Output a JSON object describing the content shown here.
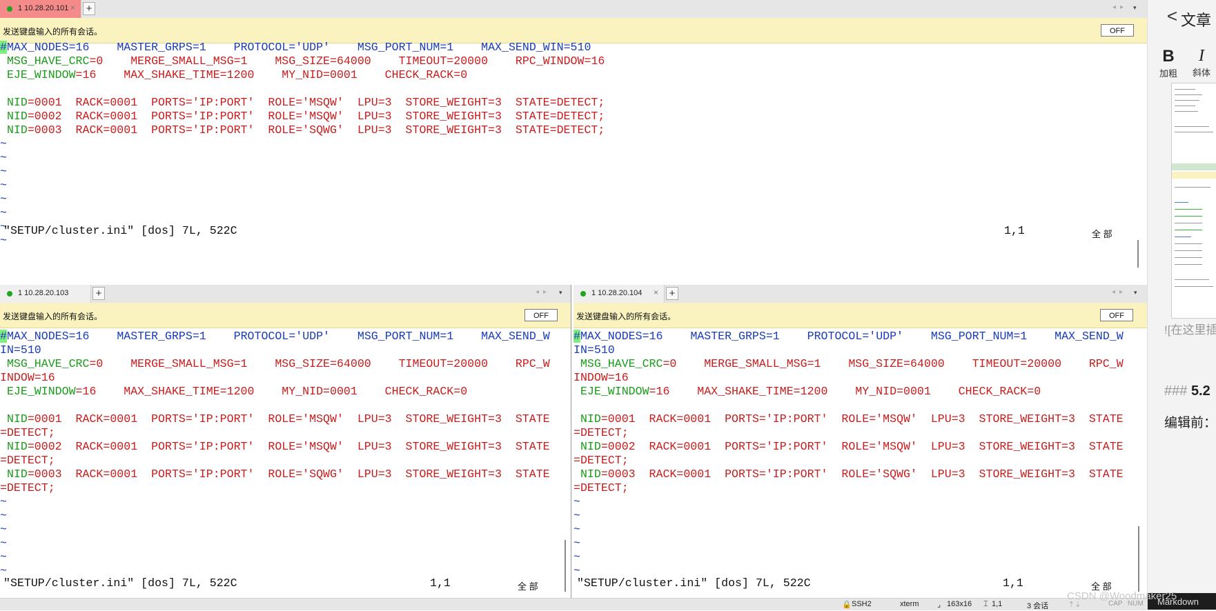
{
  "colors": {
    "key_blue": "#1a3cb8",
    "key_green": "#1a9c1a",
    "value_red": "#c81d1d",
    "plain": "#222222",
    "broadcast_bg": "#faf3c0",
    "active_tab": "#f48a8a"
  },
  "broadcast": {
    "text": "发送键盘输入的所有会话。",
    "off": "OFF"
  },
  "tabs": {
    "top": {
      "label": "1 10.28.20.101",
      "close": "×"
    },
    "bottom_left": {
      "label": "1 10.28.20.103"
    },
    "bottom_right": {
      "label": "1 10.28.20.104",
      "close": "×"
    },
    "add": "+"
  },
  "editor": {
    "tilde": "~",
    "status_file": "\"SETUP/cluster.ini\" [dos] 7L, 522C",
    "status_pos": "1,1",
    "status_all": "全 部"
  },
  "top_lines": [
    [
      [
        "#",
        "cursor"
      ],
      [
        "MAX_NODES",
        "b"
      ],
      [
        "=16    ",
        "b"
      ],
      [
        "MASTER_GRPS=1    ",
        "b"
      ],
      [
        "PROTOCOL='UDP'    ",
        "b"
      ],
      [
        "MSG_PORT_NUM=1    ",
        "b"
      ],
      [
        "MAX_SEND_WIN=510",
        "b"
      ]
    ],
    [
      [
        " MSG_HAVE_CRC",
        "g"
      ],
      [
        "=0    ",
        "r"
      ],
      [
        "MERGE_SMALL_MSG=1    ",
        "r"
      ],
      [
        "MSG_SIZE=64000    ",
        "r"
      ],
      [
        "TIMEOUT=20000    ",
        "r"
      ],
      [
        "RPC_WINDOW=16",
        "r"
      ]
    ],
    [
      [
        " EJE_WINDOW",
        "g"
      ],
      [
        "=16    ",
        "r"
      ],
      [
        "MAX_SHAKE_TIME=1200    ",
        "r"
      ],
      [
        "MY_NID=0001    ",
        "r"
      ],
      [
        "CHECK_RACK=0",
        "r"
      ]
    ],
    [
      [
        "",
        "p"
      ]
    ],
    [
      [
        " NID",
        "g"
      ],
      [
        "=0001  RACK=0001  PORTS='IP:PORT'  ROLE='MSQW'  LPU=3  STORE_WEIGHT=3  STATE=DETECT;",
        "r"
      ]
    ],
    [
      [
        " NID",
        "g"
      ],
      [
        "=0002  RACK=0001  PORTS='IP:PORT'  ROLE='MSQW'  LPU=3  STORE_WEIGHT=3  STATE=DETECT;",
        "r"
      ]
    ],
    [
      [
        " NID",
        "g"
      ],
      [
        "=0003  RACK=0001  PORTS='IP:PORT'  ROLE='SQWG'  LPU=3  STORE_WEIGHT=3  STATE=DETECT;",
        "r"
      ]
    ]
  ],
  "bottom_lines": [
    [
      [
        "#",
        "cursor"
      ],
      [
        "MAX_NODES",
        "b"
      ],
      [
        "=16    ",
        "b"
      ],
      [
        "MASTER_GRPS=1    ",
        "b"
      ],
      [
        "PROTOCOL='UDP'    ",
        "b"
      ],
      [
        "MSG_PORT_NUM=1    ",
        "b"
      ],
      [
        "MAX_SEND_W",
        "b"
      ]
    ],
    [
      [
        "IN=510",
        "b"
      ]
    ],
    [
      [
        " MSG_HAVE_CRC",
        "g"
      ],
      [
        "=0    ",
        "r"
      ],
      [
        "MERGE_SMALL_MSG=1    ",
        "r"
      ],
      [
        "MSG_SIZE=64000    ",
        "r"
      ],
      [
        "TIMEOUT=20000    ",
        "r"
      ],
      [
        "RPC_W",
        "r"
      ]
    ],
    [
      [
        "INDOW=16",
        "r"
      ]
    ],
    [
      [
        " EJE_WINDOW",
        "g"
      ],
      [
        "=16    ",
        "r"
      ],
      [
        "MAX_SHAKE_TIME=1200    ",
        "r"
      ],
      [
        "MY_NID=0001    ",
        "r"
      ],
      [
        "CHECK_RACK=0",
        "r"
      ]
    ],
    [
      [
        "",
        "p"
      ]
    ],
    [
      [
        " NID",
        "g"
      ],
      [
        "=0001  RACK=0001  PORTS='IP:PORT'  ROLE='MSQW'  LPU=3  STORE_WEIGHT=3  STATE",
        "r"
      ]
    ],
    [
      [
        "=DETECT;",
        "r"
      ]
    ],
    [
      [
        " NID",
        "g"
      ],
      [
        "=0002  RACK=0001  PORTS='IP:PORT'  ROLE='MSQW'  LPU=3  STORE_WEIGHT=3  STATE",
        "r"
      ]
    ],
    [
      [
        "=DETECT;",
        "r"
      ]
    ],
    [
      [
        " NID",
        "g"
      ],
      [
        "=0003  RACK=0001  PORTS='IP:PORT'  ROLE='SQWG'  LPU=3  STORE_WEIGHT=3  STATE",
        "r"
      ]
    ],
    [
      [
        "=DETECT;",
        "r"
      ]
    ]
  ],
  "statusbar": {
    "ssh": "SSH2",
    "term": "xterm",
    "size": "163x16",
    "pos": "1,1",
    "sessions": "3 会话",
    "cap": "CAP",
    "num": "NUM"
  },
  "sidebar": {
    "back": "<",
    "title": "文章",
    "bold_glyph": "B",
    "bold_label": "加粗",
    "italic_glyph": "I",
    "italic_label": "斜体",
    "image_placeholder": "![在这里插",
    "heading_marks": "###",
    "heading_number": "5.2",
    "before_edit": "编辑前：",
    "bottom_text": "Markdown"
  },
  "watermark": "CSDN @Woodmaker25"
}
